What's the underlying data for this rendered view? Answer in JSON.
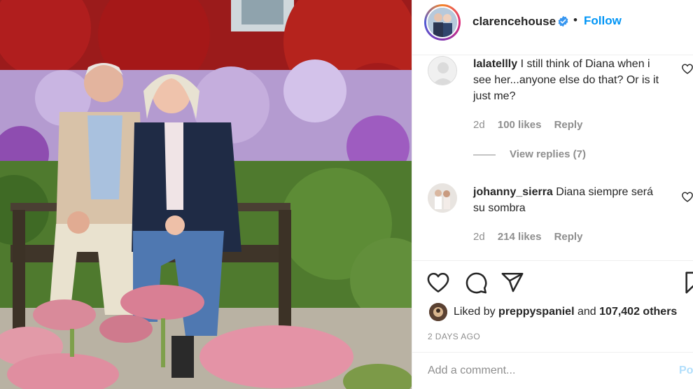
{
  "header": {
    "username": "clarencehouse",
    "separator": "•",
    "follow_label": "Follow"
  },
  "comments": [
    {
      "username": "lalatellly",
      "text": "I still think of Diana when i see her...anyone else do that? Or is it just me?",
      "age": "2d",
      "likes": "100 likes",
      "reply_label": "Reply",
      "view_replies": "View replies (7)"
    },
    {
      "username": "johanny_sierra",
      "text": "Diana siempre será su sombra",
      "age": "2d",
      "likes": "214 likes",
      "reply_label": "Reply"
    }
  ],
  "likes": {
    "prefix": "Liked by",
    "user": "preppyspaniel",
    "conjunction": "and",
    "others": "107,402 others"
  },
  "timestamp": "2 DAYS AGO",
  "add_comment": {
    "placeholder": "Add a comment...",
    "post_label": "Post"
  },
  "icons": {
    "verified": "verified-badge-icon",
    "like": "heart-icon",
    "comment": "comment-bubble-icon",
    "share": "paper-plane-icon",
    "save": "bookmark-icon"
  },
  "colors": {
    "accent": "#0095f6",
    "verified": "#3897f0",
    "muted": "#8e8e8e",
    "post_disabled": "#b2dffc"
  }
}
